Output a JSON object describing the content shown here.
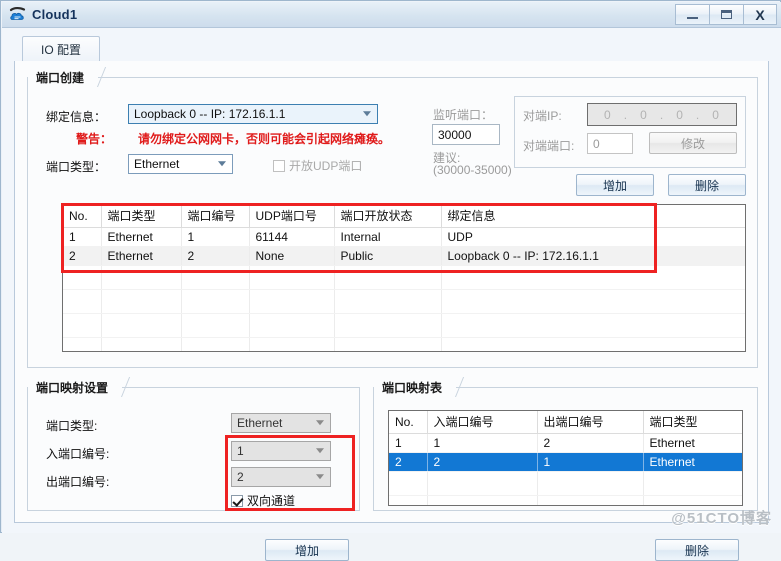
{
  "window": {
    "title": "Cloud1",
    "icon": "cloud-device-icon",
    "minimize_label": "–",
    "maximize_label": "❐",
    "close_label": "X"
  },
  "tabs": [
    {
      "label": "IO 配置",
      "name": "tab-io-config"
    }
  ],
  "port_create": {
    "group_title": "端口创建",
    "bind_info_label": "绑定信息：",
    "bind_info_value": "Loopback 0 -- IP: 172.16.1.1",
    "warning_label": "警告：",
    "warning_text": "请勿绑定公网网卡，否则可能会引起网络瘫痪。",
    "port_type_label": "端口类型：",
    "port_type_value": "Ethernet",
    "open_udp_label": "开放UDP端口",
    "open_udp_checked": false,
    "listen_port_label": "监听端口：",
    "listen_port_value": "30000",
    "suggest_line1": "建议:",
    "suggest_line2": "(30000-35000)",
    "peer_ip_label": "对端IP:",
    "peer_ip_octets": [
      "0",
      "0",
      "0",
      "0"
    ],
    "peer_port_label": "对端端口:",
    "peer_port_value": "0",
    "modify_button": "修改",
    "add_button": "增加",
    "delete_button": "删除"
  },
  "port_table": {
    "columns": [
      "No.",
      "端口类型",
      "端口编号",
      "UDP端口号",
      "端口开放状态",
      "绑定信息"
    ],
    "rows": [
      [
        "1",
        "Ethernet",
        "1",
        "61144",
        "Internal",
        "UDP"
      ],
      [
        "2",
        "Ethernet",
        "2",
        "None",
        "Public",
        "Loopback 0 -- IP: 172.16.1.1"
      ]
    ],
    "empty_row_count": 6
  },
  "port_mapping_settings": {
    "group_title": "端口映射设置",
    "port_type_label": "端口类型:",
    "port_type_value": "Ethernet",
    "in_port_label": "入端口编号:",
    "in_port_value": "1",
    "out_port_label": "出端口编号:",
    "out_port_value": "2",
    "bidirectional_label": "双向通道",
    "bidirectional_checked": true,
    "add_button": "增加"
  },
  "port_mapping_table": {
    "group_title": "端口映射表",
    "columns": [
      "No.",
      "入端口编号",
      "出端口编号",
      "端口类型"
    ],
    "rows": [
      {
        "cells": [
          "1",
          "1",
          "2",
          "Ethernet"
        ],
        "selected": false
      },
      {
        "cells": [
          "2",
          "2",
          "1",
          "Ethernet"
        ],
        "selected": true
      }
    ],
    "empty_row_count": 3,
    "delete_button": "删除"
  },
  "watermark": "@51CTO博客",
  "colors": {
    "selection": "#1278d4",
    "warning": "#e01b1b",
    "annotation": "#ee2222",
    "title_text": "#15335c"
  }
}
